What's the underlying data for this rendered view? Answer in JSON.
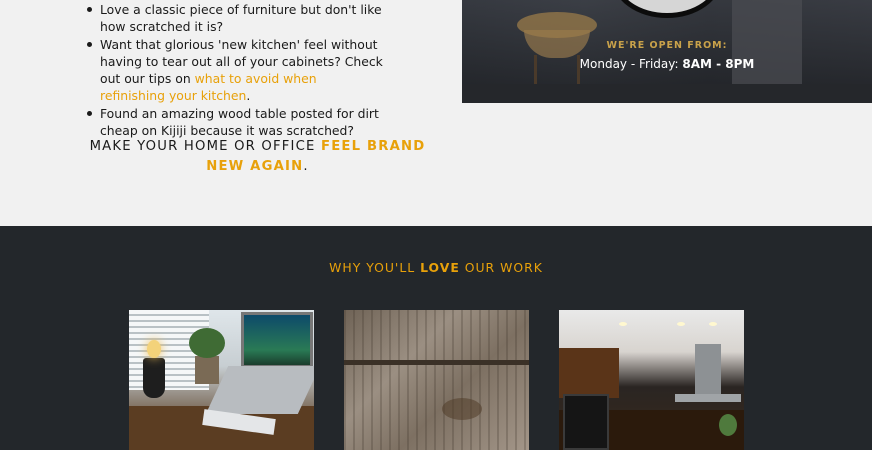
{
  "intro": {
    "bullets": [
      {
        "text": "Love a classic piece of furniture but don't like how scratched it is?"
      },
      {
        "before": "Want that glorious 'new kitchen' feel without having to tear out all of your cabinets? Check out our tips on ",
        "link": "what to avoid when refinishing your kitchen",
        "after": "."
      },
      {
        "text": "Found an amazing wood table posted for dirt cheap on Kijiji because it was scratched?"
      }
    ],
    "tagline": {
      "before": "MAKE YOUR HOME OR OFFICE ",
      "highlight": "FEEL BRAND NEW AGAIN",
      "after": "."
    }
  },
  "hours": {
    "label": "WE'RE OPEN FROM:",
    "days": "Monday - Friday: ",
    "time": "8AM - 8PM"
  },
  "why": {
    "before": "WHY YOU'LL ",
    "bold": "LOVE",
    "after": " OUR WORK"
  },
  "colors": {
    "accent": "#e8a10a",
    "dark_bg": "#23272b",
    "light_bg": "#f1f1f1"
  }
}
